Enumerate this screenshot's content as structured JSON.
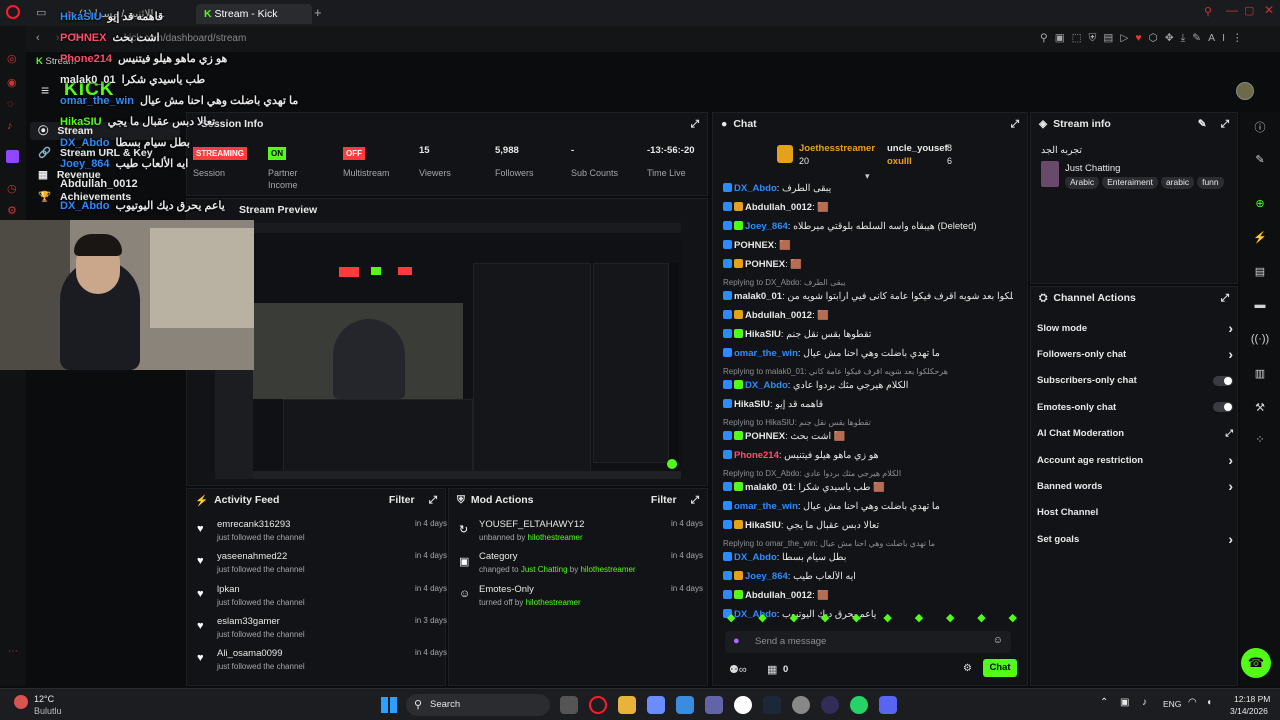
{
  "browser": {
    "tab_inactive": "(1) الإثنين / مسرا ...",
    "tab_active": "Stream - Kick Dashboard",
    "address": "kick.com/dashboard/stream",
    "sidebar_tag": "Stream"
  },
  "kick_sidebar": {
    "items": [
      {
        "icon": "⦿",
        "label": "Stream"
      },
      {
        "icon": "🔗",
        "label": "Stream URL & Key"
      },
      {
        "icon": "▦",
        "label": "Revenue"
      },
      {
        "icon": "🏆",
        "label": "Achievements"
      }
    ]
  },
  "session_info": {
    "title": "Session Info",
    "stats": [
      {
        "value": "STREAMING",
        "label": "Session"
      },
      {
        "value": "ON",
        "label": "Partner Income"
      },
      {
        "value": "OFF",
        "label": "Multistream"
      },
      {
        "value": "15",
        "label": "Viewers"
      },
      {
        "value": "5,988",
        "label": "Followers"
      },
      {
        "value": "-",
        "label": "Sub Counts"
      },
      {
        "value": "-13:-56:-20",
        "label": "Time Live"
      }
    ]
  },
  "stream_preview": {
    "title": "Stream Preview"
  },
  "activity_feed": {
    "title": "Activity Feed",
    "filter": "Filter",
    "items": [
      {
        "name": "emrecank316293",
        "sub": "just followed the channel",
        "time": "in 4 days"
      },
      {
        "name": "yaseenahmed22",
        "sub": "just followed the channel",
        "time": "in 4 days"
      },
      {
        "name": "lpkan",
        "sub": "just followed the channel",
        "time": "in 4 days"
      },
      {
        "name": "eslam33gamer",
        "sub": "just followed the channel",
        "time": "in 3 days"
      },
      {
        "name": "Ali_osama0099",
        "sub": "just followed the channel",
        "time": "in 4 days"
      }
    ]
  },
  "mod_actions": {
    "title": "Mod Actions",
    "filter": "Filter",
    "items": [
      {
        "icon": "↻",
        "name": "YOUSEF_ELTAHAWY12",
        "pre": "unbanned by",
        "who": "hilothestreamer",
        "mid": "",
        "time": "in 4 days"
      },
      {
        "icon": "▣",
        "name": "Category",
        "pre": "changed to",
        "who": "Just Chatting",
        "mid": "by",
        "by": "hilothestreamer",
        "time": "in 4 days"
      },
      {
        "icon": "☺",
        "name": "Emotes-Only",
        "pre": "turned off by",
        "who": "hilothestreamer",
        "mid": "",
        "time": "in 4 days"
      }
    ]
  },
  "chat": {
    "title": "Chat",
    "top_gifters": [
      {
        "name": "Joethesstreamer",
        "count": "20"
      },
      {
        "name": "uncle_yousef",
        "count": "8"
      },
      {
        "name": "oxulll",
        "count": "6"
      }
    ],
    "messages": [
      {
        "user": "DX_Abdo",
        "color": "#2b8cff",
        "text": "يبقى الطرف"
      },
      {
        "user": "Abdullah_0012",
        "color": "#e8e8e8",
        "text": "🟫"
      },
      {
        "user": "Joey_864",
        "color": "#2b8cff",
        "text": "هيبقاه واسه السلطه بلوقتي ميرطلاه (Deleted)"
      },
      {
        "user": "POHNEX",
        "color": "#e8e8e8",
        "text": "🟫"
      },
      {
        "user": "POHNEX",
        "color": "#e8e8e8",
        "text": "🟫"
      },
      {
        "reply": "Replying to DX_Abdo: يبقى الطرف"
      },
      {
        "user": "malak0_01",
        "color": "#e8e8e8",
        "text": "هرحكلكوا بعد شويه اقرف فيكوا عامة كانى فيي ارابتوا شويه من"
      },
      {
        "user": "Abdullah_0012",
        "color": "#e8e8e8",
        "text": "🟫"
      },
      {
        "user": "HikaSIU",
        "color": "#e8e8e8",
        "text": "تقطوها بقس نقل جنم"
      },
      {
        "user": "omar_the_win",
        "color": "#2b8cff",
        "text": "ما تهدي باضلت وهي احنا مش عيال"
      },
      {
        "reply": "Replying to malak0_01: هرحكلكوا بعد شويه اقرف فيكوا عامة كاني"
      },
      {
        "user": "DX_Abdo",
        "color": "#2b8cff",
        "text": "الكلام هيرجي مثك بردوا عادي"
      },
      {
        "user": "HikaSIU",
        "color": "#e8e8e8",
        "text": "قاهمه قد إيو"
      },
      {
        "reply": "Replying to HikaSIU: تقطوها بقس نقل جنم"
      },
      {
        "user": "POHNEX",
        "color": "#e8e8e8",
        "text": "اشت بحث 🟫"
      },
      {
        "user": "Phone214",
        "color": "#ff4d6d",
        "text": "هو زي ماهو هيلو فيتنيس"
      },
      {
        "reply": "Replying to DX_Abdo: الكلام هيرجي مثك بردوا عادي"
      },
      {
        "user": "malak0_01",
        "color": "#e8e8e8",
        "text": "طب ياسيدي شكرا 🟫"
      },
      {
        "user": "omar_the_win",
        "color": "#2b8cff",
        "text": "ما تهدي باضلت وهي احنا مش عيال"
      },
      {
        "user": "HikaSIU",
        "color": "#e8e8e8",
        "text": "تعالا دبس عقبال ما يجي"
      },
      {
        "reply": "Replying to omar_the_win: ما تهدي باضلت وهي احنا مش عيال"
      },
      {
        "user": "DX_Abdo",
        "color": "#2b8cff",
        "text": "بطل سيام بسطا"
      },
      {
        "user": "Joey_864",
        "color": "#2b8cff",
        "text": "ايه الألعاب طيب"
      },
      {
        "user": "Abdullah_0012",
        "color": "#e8e8e8",
        "text": "🟫"
      },
      {
        "user": "DX_Abdo",
        "color": "#2b8cff",
        "text": "ياعم يحرق ديك اليوتيوب"
      }
    ],
    "placeholder": "Send a message",
    "chat_button": "Chat",
    "points": "0"
  },
  "stream_info": {
    "title": "Stream info",
    "stream_title": "تجربه الجد",
    "category": "Just Chatting",
    "tags": [
      "Arabic",
      "Enteraiment",
      "arabic",
      "funn"
    ]
  },
  "channel_actions": {
    "title": "Channel Actions",
    "items": [
      {
        "label": "Slow mode",
        "control": "chevron"
      },
      {
        "label": "Followers-only chat",
        "control": "chevron"
      },
      {
        "label": "Subscribers-only chat",
        "control": "toggle"
      },
      {
        "label": "Emotes-only chat",
        "control": "toggle"
      },
      {
        "label": "AI Chat Moderation",
        "control": "external"
      },
      {
        "label": "Account age restriction",
        "control": "chevron"
      },
      {
        "label": "Banned words",
        "control": "chevron"
      },
      {
        "label": "Host Channel",
        "control": "none"
      },
      {
        "label": "Set goals",
        "control": "chevron"
      }
    ]
  },
  "overlay_chat": [
    {
      "user": "HikaSIU",
      "text": "قاهمه قد إيو"
    },
    {
      "user": "POHNEX",
      "text": "اشت بحث"
    },
    {
      "user": "Phone214",
      "text": "هو زي ماهو هيلو فيتنيس"
    },
    {
      "user": "malak0_01",
      "text": "طب ياسيدي شكرا"
    },
    {
      "user": "omar_the_win",
      "text": "ما تهدي باضلت وهي احنا مش عيال"
    },
    {
      "user": "HikaSIU",
      "text": "تعالا دبس عقبال ما يجي"
    },
    {
      "user": "DX_Abdo",
      "text": "بطل سيام بسطا"
    },
    {
      "user": "Joey_864",
      "text": "ايه الألعاب طيب"
    },
    {
      "user": "Abdullah_0012",
      "text": ""
    },
    {
      "user": "DX_Abdo",
      "text": "ياعم يحرق ديك اليوتيوب"
    }
  ],
  "taskbar": {
    "temp": "12°C",
    "weather": "Bulutlu",
    "search": "Search",
    "lang": "ENG",
    "time": "12:18 PM",
    "date": "3/14/2026"
  },
  "colors": {
    "accent": "#53fc18",
    "red": "#ff3b3b",
    "link": "#2b8cff"
  }
}
